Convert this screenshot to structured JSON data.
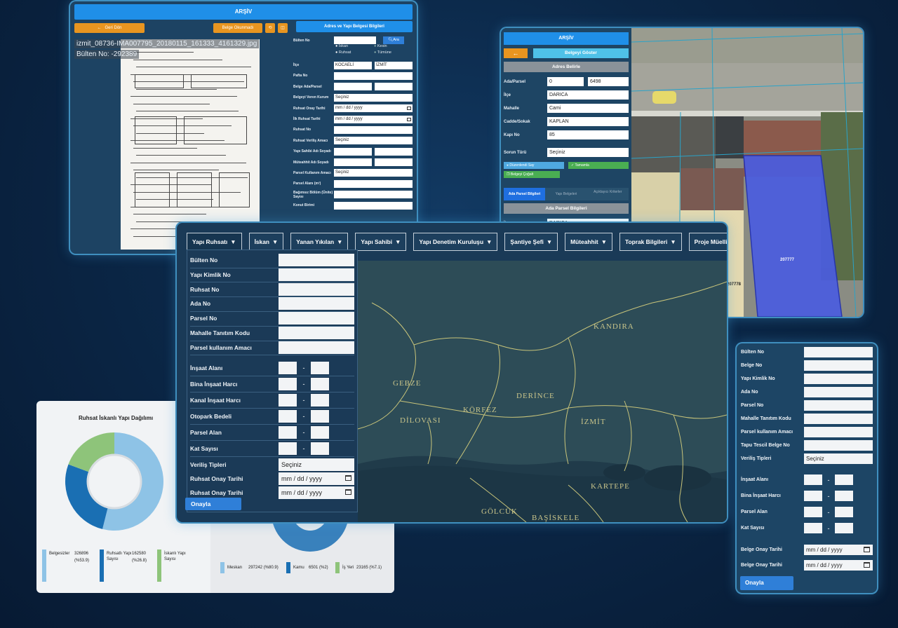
{
  "archive_doc": {
    "title": "ARŞİV",
    "back_label": "Geri Dön",
    "doc_read_label": "Belge Okunmadı",
    "form_title": "Adres ve Yapı Belgesi Bilgileri",
    "file_name": "izmit_08736-IMA007795_20180115_161333_4161329.jpg",
    "bulletin_no": "Bülten No: -292389",
    "search_label": "Ara",
    "fields": [
      {
        "label": "Bülten No",
        "value": ""
      },
      {
        "label": "İlçe",
        "value": "KOCAELİ",
        "value2": "İZMİT"
      },
      {
        "label": "Pafta No",
        "value": ""
      },
      {
        "label": "Belge Ada/Parsel",
        "value": "",
        "value2": ""
      },
      {
        "label": "Belgeyi Veren Kurum",
        "value": "Seçiniz"
      },
      {
        "label": "Ruhsat Onay Tarihi",
        "value": "mm / dd / yyyy"
      },
      {
        "label": "İlk Ruhsat Tarihi",
        "value": "mm / dd / yyyy"
      },
      {
        "label": "Ruhsat No",
        "value": ""
      },
      {
        "label": "Ruhsat Veriliş Amacı",
        "value": "Seçiniz"
      },
      {
        "label": "Yapı Sahibi Adı Soyadı",
        "value": "",
        "value2": ""
      },
      {
        "label": "Müteahhit Adı Soyadı",
        "value": "",
        "value2": ""
      },
      {
        "label": "Parsel Kullanım Amacı",
        "value": "Seçiniz"
      },
      {
        "label": "Parsel Alanı (m²)",
        "value": ""
      },
      {
        "label": "Bağımsız Bölüm (Ünite) Sayısı",
        "value": ""
      },
      {
        "label": "Konut Birimi",
        "value": ""
      }
    ],
    "radios": [
      "İskan",
      "Kesin",
      "Ruhsat",
      "Tümüne"
    ]
  },
  "map_parcel": {
    "title": "ARŞİV",
    "show_doc_label": "Belgeyi Göster",
    "address_section": "Adres Belirle",
    "fields": [
      {
        "label": "Ada/Parsel",
        "value": "0",
        "value2": "6498"
      },
      {
        "label": "İlçe",
        "value": "DARICA"
      },
      {
        "label": "Mahalle",
        "value": "Cami"
      },
      {
        "label": "Cadde/Sokak",
        "value": "KAPLAN"
      },
      {
        "label": "Kapı No",
        "value": "85"
      },
      {
        "label": "Sorun Türü",
        "value": "Seçiniz"
      }
    ],
    "action_1": "Düzenlendi Say",
    "action_2": "Tamamla",
    "action_3": "Belgeyi Çoğalt",
    "tabs": [
      "Ada Parsel Bilgileri",
      "Yapı Belgeleri",
      "Açıklayıcı Kriterler"
    ],
    "parcel_section": "Ada Parsel Bilgileri",
    "ilce_label": "İlçe",
    "ilce_value": "DARICA",
    "parcel_id": "207777",
    "parcel_id2": "207778"
  },
  "donut": {
    "title": "Ruhsat İskanlı Yapı Dağılımı",
    "legend": [
      {
        "name": "Belgesizler",
        "value": "326896",
        "pct": "(%53.9)",
        "color": "#8ec3e6"
      },
      {
        "name": "Ruhsatlı Yapı Sayısı",
        "value": "162580",
        "pct": "(%26.8)",
        "color": "#1a6fb3"
      },
      {
        "name": "İskanlı Yapı Sayısı",
        "value": "",
        "pct": "",
        "color": "#8ec47a"
      }
    ],
    "legend2": [
      {
        "name": "Meskan",
        "value": "297242 (%80.9)",
        "color": "#8ec3e6"
      },
      {
        "name": "Kamu",
        "value": "6501 (%2)",
        "color": "#1a6fb3"
      },
      {
        "name": "İş Yeri",
        "value": "23165 (%7.1)",
        "color": "#8ec47a"
      }
    ]
  },
  "chart_data": {
    "type": "pie",
    "title": "Ruhsat İskanlı Yapı Dağılımı",
    "categories": [
      "Belgesizler",
      "Ruhsatlı Yapı Sayısı",
      "İskanlı Yapı Sayısı"
    ],
    "values": [
      53.9,
      26.8,
      19.3
    ],
    "colors": [
      "#8ec3e6",
      "#1a6fb3",
      "#8ec47a"
    ]
  },
  "right_form": {
    "fields": [
      "Bülten No",
      "Belge No",
      "Yapı Kimlik No",
      "Ada No",
      "Parsel No",
      "Mahalle Tanıtım Kodu",
      "Parsel kullanım Amacı",
      "Tapu Tescil Belge No"
    ],
    "verilis_label": "Veriliş Tipleri",
    "verilis_value": "Seçiniz",
    "ranges": [
      "İnşaat Alanı",
      "Bina İnşaat Harcı",
      "Parsel Alan",
      "Kat Sayısı"
    ],
    "dates": [
      "Belge Onay Tarihi",
      "Belge Onay Tarihi"
    ],
    "date_placeholder": "mm / dd / yyyy",
    "submit": "Onayla"
  },
  "main": {
    "nav": [
      "Yapı Ruhsatı",
      "İskan",
      "Yanan Yıkılan",
      "Yapı Sahibi",
      "Yapı Denetim Kuruluşu",
      "Şantiye Şefi",
      "Müteahhit",
      "Toprak Bilgileri",
      "Proje Müellifi"
    ],
    "text_fields": [
      "Bülten No",
      "Yapı Kimlik No",
      "Ruhsat No",
      "Ada No",
      "Parsel No",
      "Mahalle Tanıtım Kodu",
      "Parsel kullanım Amacı"
    ],
    "range_fields": [
      "İnşaat Alanı",
      "Bina İnşaat Harcı",
      "Kanal İnşaat Harcı",
      "Otopark Bedeli",
      "Parsel Alan",
      "Kat Sayısı"
    ],
    "verilis_label": "Veriliş Tipleri",
    "verilis_value": "Seçiniz",
    "dates": [
      "Ruhsat Onay Tarihi",
      "Ruhsat Onay Tarihi"
    ],
    "date_placeholder": "mm / dd / yyyy",
    "submit": "Onayla",
    "map_labels": [
      "KANDIRA",
      "GEBZE",
      "DİLOVASI",
      "KÖRFEZ",
      "DERİNCE",
      "İZMİT",
      "KARTEPE",
      "GÖLCÜK",
      "BAŞİSKELE"
    ]
  }
}
